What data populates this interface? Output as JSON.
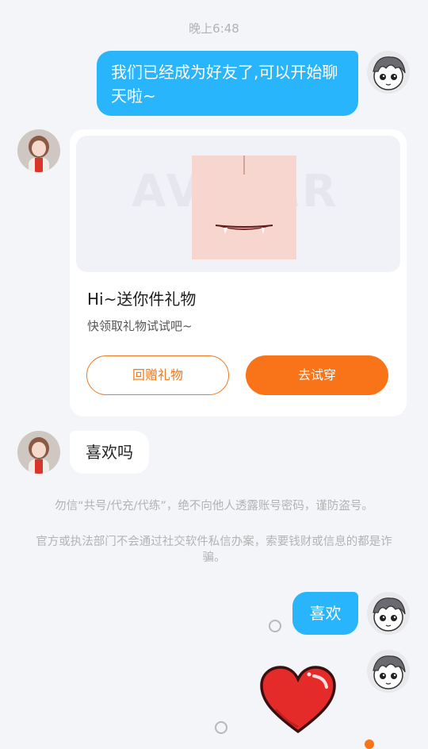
{
  "chat": {
    "timestamp": "晚上6:48",
    "messages": {
      "me_1": "我们已经成为好友了,可以开始聊天啦~",
      "friend_1": "喜欢吗",
      "me_2": "喜欢"
    },
    "gift_card": {
      "title": "Hi~送你件礼物",
      "subtitle": "快领取礼物试试吧~",
      "return_gift_label": "回赠礼物",
      "try_on_label": "去试穿",
      "banner_watermark": "AVATAR"
    },
    "notices": {
      "line1": "勿信“共号/代充/代练”，绝不向他人透露账号密码，谨防盗号。",
      "line2": "官方或执法部门不会通过社交软件私信办案，索要钱财或信息的都是诈骗。"
    }
  },
  "colors": {
    "sent_bubble": "#29b5fb",
    "accent_orange": "#f97419",
    "background": "#f4f5f9"
  },
  "icons": {
    "sticker": "red-heart-sticker",
    "message_status": "unread-circle-icon"
  }
}
